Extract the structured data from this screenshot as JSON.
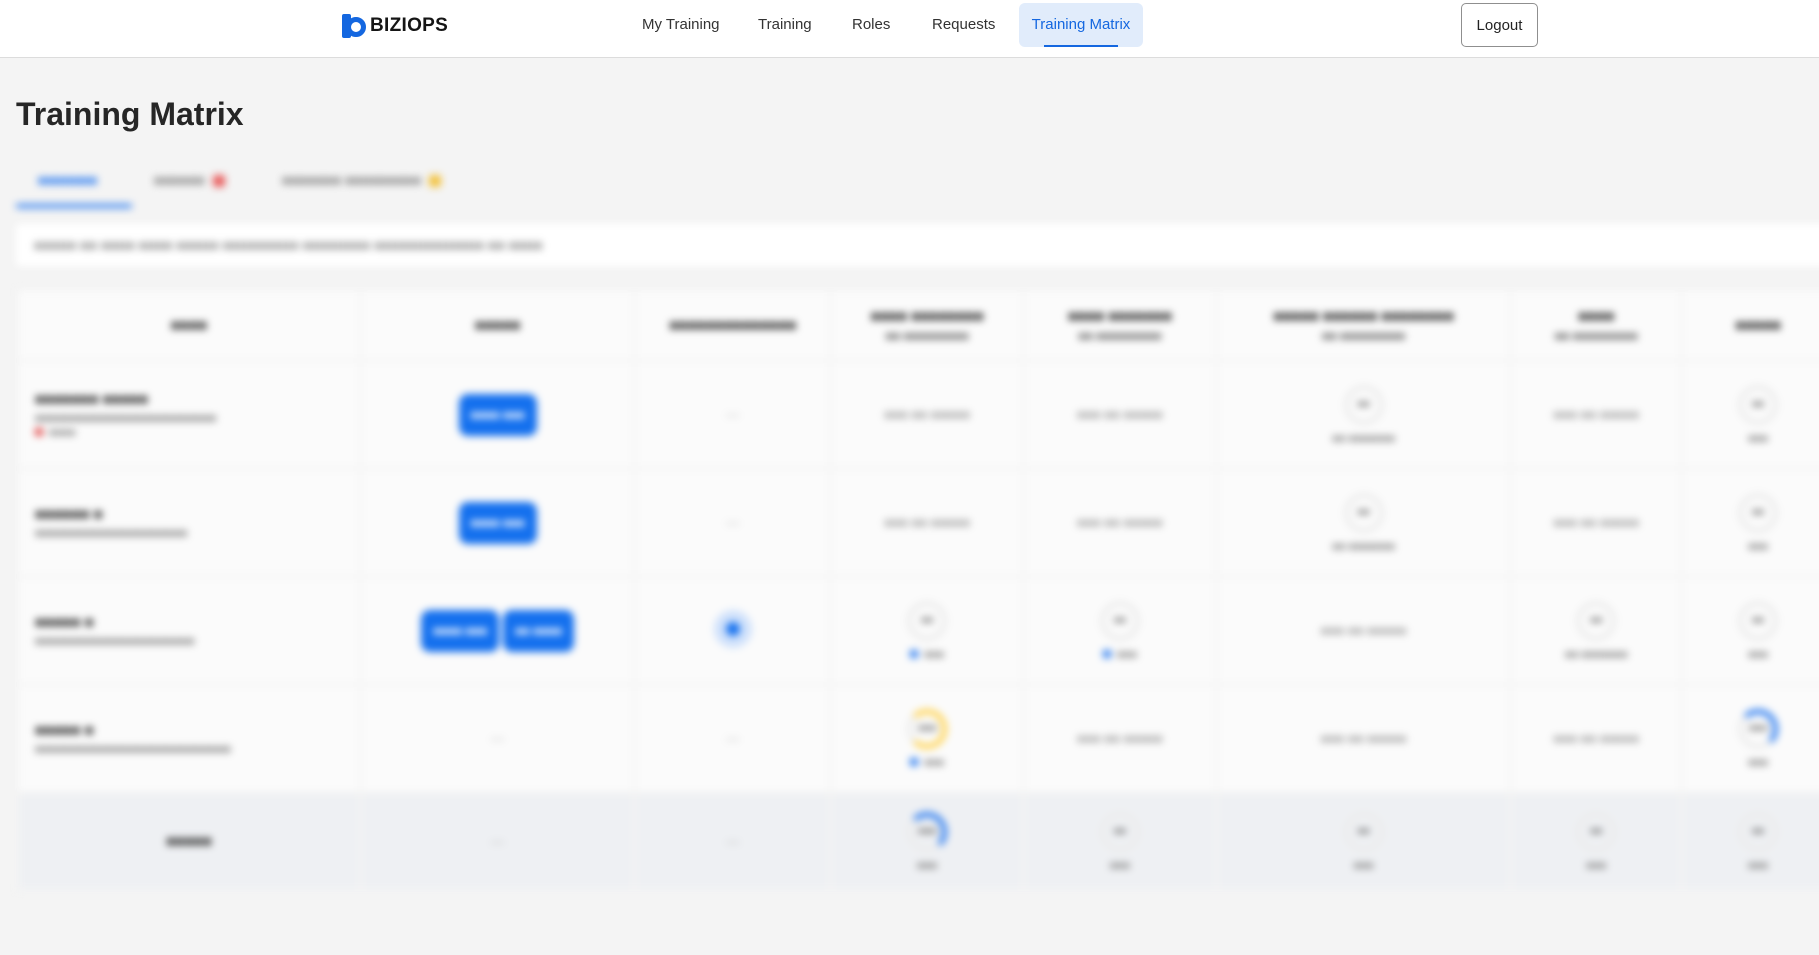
{
  "app": {
    "logo_text": "BIZIOPS",
    "brand_color": "#1467e0"
  },
  "nav": {
    "items": [
      {
        "label": "My Training"
      },
      {
        "label": "Training"
      },
      {
        "label": "Roles"
      },
      {
        "label": "Requests"
      },
      {
        "label": "Training Matrix"
      }
    ],
    "active_index": 4,
    "logout_label": "Logout"
  },
  "page": {
    "title": "Training Matrix"
  }
}
